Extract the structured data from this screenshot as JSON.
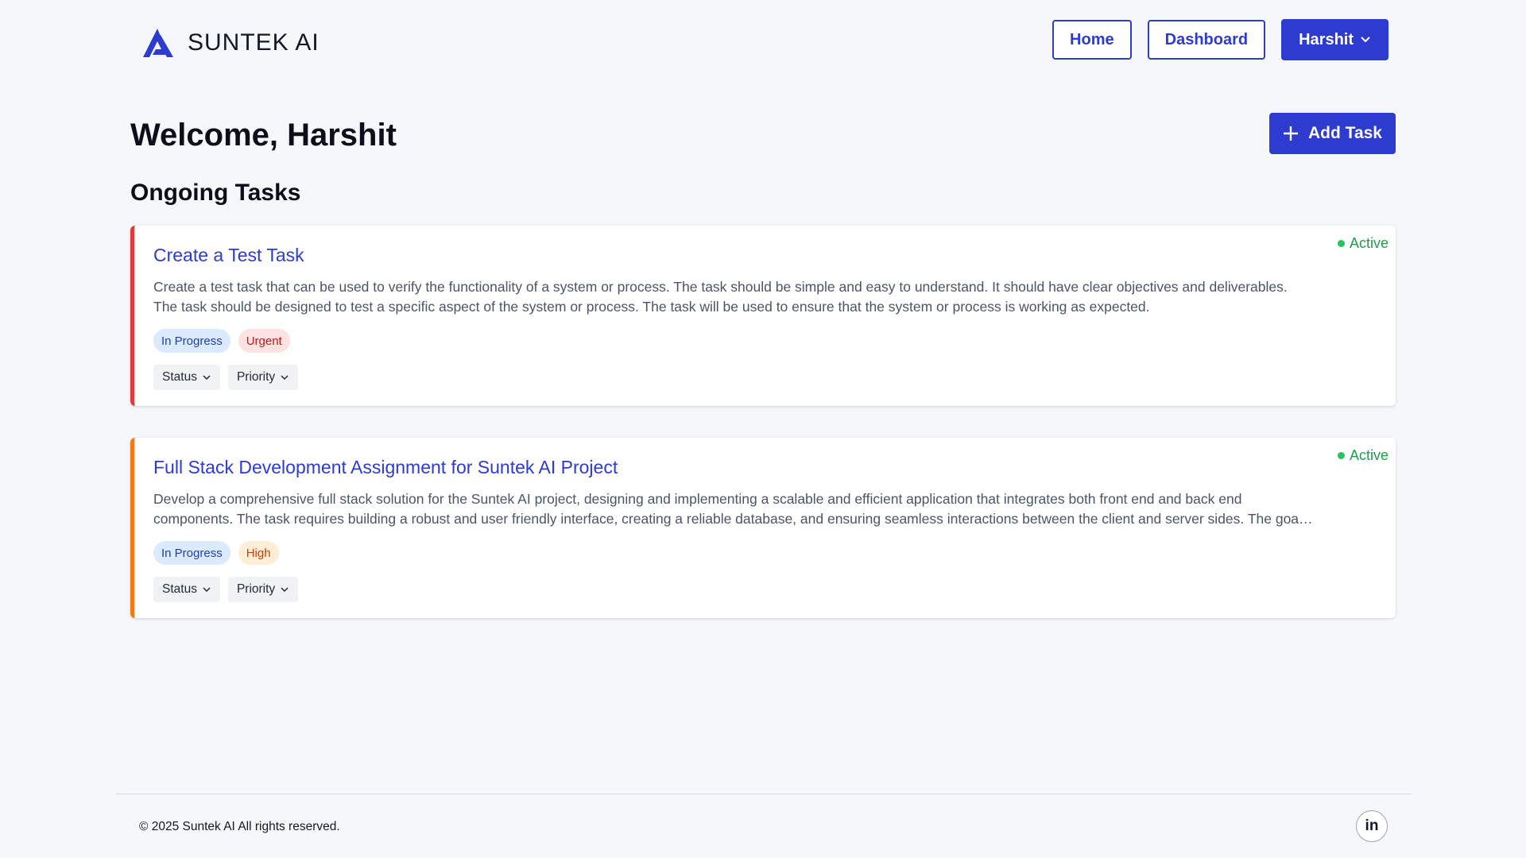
{
  "brand": {
    "name": "SUNTEK AI",
    "logo_icon": "suntek-logo-icon",
    "accent": "#2d3bcf"
  },
  "nav": {
    "home": "Home",
    "dashboard": "Dashboard",
    "user": "Harshit"
  },
  "main": {
    "welcome": "Welcome, Harshit",
    "add_task": "Add Task",
    "section_title": "Ongoing Tasks"
  },
  "tasks": [
    {
      "title": "Create a Test Task",
      "description": "Create a test task that can be used to verify the functionality of a system or process. The task should be simple and easy to understand. It should have clear objectives and deliverables. The task should be designed to test a specific aspect of the system or process. The task will be used to ensure that the system or process is working as expected.",
      "state": "Active",
      "status_tag": "In Progress",
      "priority_tag": "Urgent",
      "status_dropdown": "Status",
      "priority_dropdown": "Priority",
      "accent": "#e03a3a"
    },
    {
      "title": "Full Stack Development Assignment for Suntek AI Project",
      "description": "Develop a comprehensive full stack solution for the Suntek AI project, designing and implementing a scalable and efficient application that integrates both front end and back end components. The task requires building a robust and user friendly interface, creating a reliable database, and ensuring seamless interactions between the client and server sides. The goal is t...",
      "state": "Active",
      "status_tag": "In Progress",
      "priority_tag": "High",
      "status_dropdown": "Status",
      "priority_dropdown": "Priority",
      "accent": "#f07a1a"
    }
  ],
  "footer": {
    "copyright": "© 2025 Suntek AI All rights reserved.",
    "linkedin_label": "in"
  }
}
